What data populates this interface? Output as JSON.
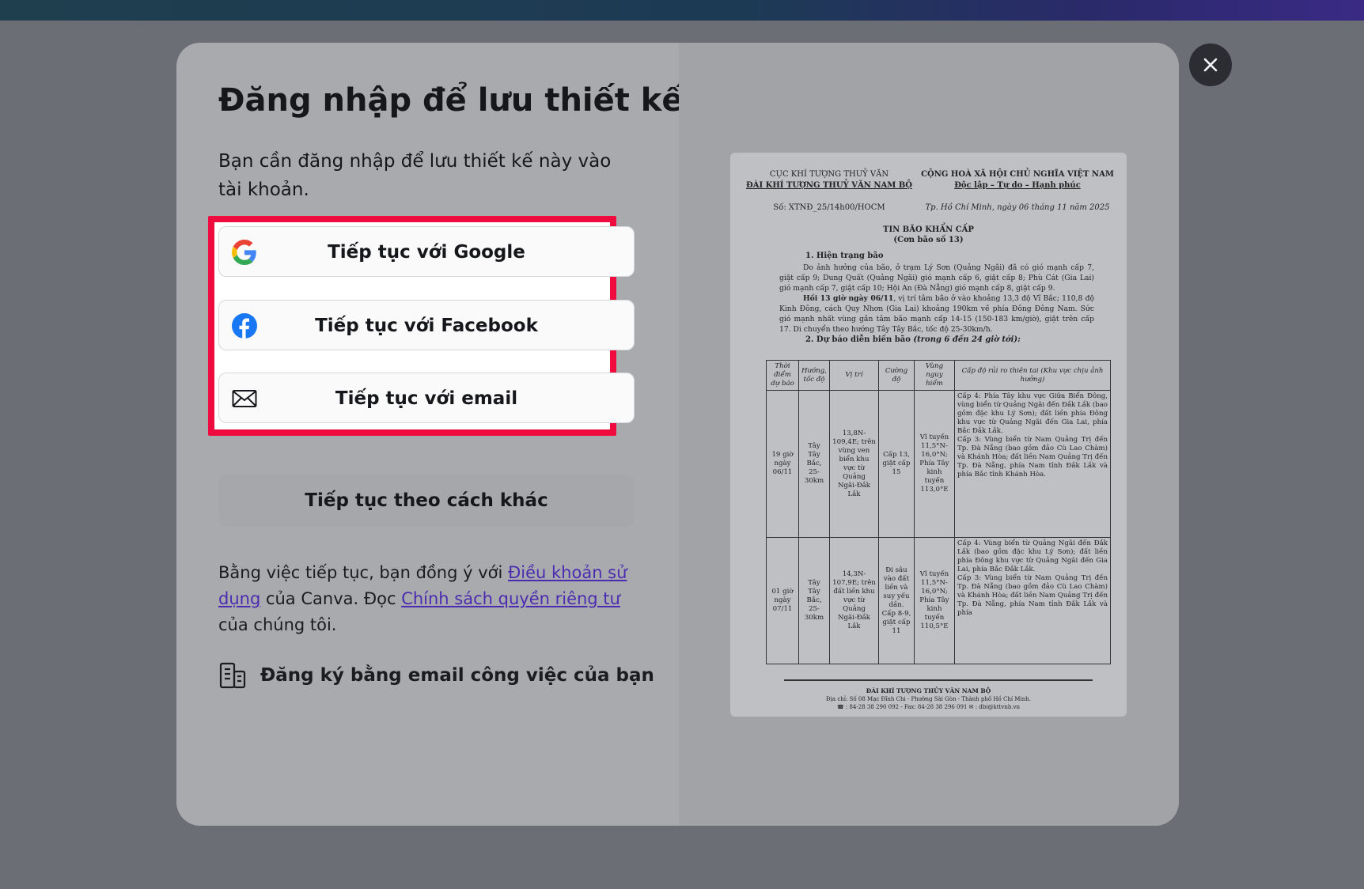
{
  "modal": {
    "title": "Đăng nhập để lưu thiết kế",
    "subtitle": "Bạn cần đăng nhập để lưu thiết kế này vào tài khoản.",
    "buttons": {
      "google": "Tiếp tục với Google",
      "facebook": "Tiếp tục với Facebook",
      "email": "Tiếp tục với email",
      "other": "Tiếp tục theo cách khác"
    },
    "terms": {
      "part1": "Bằng việc tiếp tục, bạn đồng ý với ",
      "terms_link": "Điều khoản sử dụng",
      "part2": " của Canva. Đọc ",
      "privacy_link": "Chính sách quyền riêng tư",
      "part3": " của chúng tôi."
    },
    "work_signup": "Đăng ký bằng email công việc của bạn",
    "highlight_color": "#ef0b3d",
    "link_color": "#4b2bb0"
  },
  "document": {
    "agency1": "CỤC KHÍ TƯỢNG THUỶ VĂN",
    "agency2": "ĐÀI KHÍ TƯỢNG THUỶ VĂN NAM BỘ",
    "country1": "CỘNG HOÀ XÃ HỘI CHỦ NGHĨA VIỆT NAM",
    "country2": "Độc lập – Tự do – Hạnh phúc",
    "number": "Số: XTNĐ_25/14h00/HOCM",
    "date": "Tp. Hồ Chí Minh, ngày 06 tháng 11 năm 2025",
    "heading": "TIN BÃO KHẨN CẤP",
    "subheading": "(Cơn bão số 13)",
    "section1": "1.  Hiện trạng bão",
    "para1": "Do ảnh hưởng của bão, ở trạm Lý Sơn (Quảng Ngãi) đã có gió mạnh cấp 7, giật cấp 9; Dung Quất (Quảng Ngãi) gió mạnh cấp 6, giật cấp 8; Phù Cát (Gia Lai) gió mạnh cấp 7, giật cấp 10; Hội An (Đà Nẵng) gió mạnh cấp 8, giật cấp 9.",
    "para2_bold": "Hồi 13 giờ ngày 06/11",
    "para2": ", vị trí tâm bão ở vào khoảng 13,3 độ Vĩ Bắc; 110,8 độ Kinh Đông, cách Quy Nhơn (Gia Lai) khoảng 190km về phía Đông Đông Nam. Sức gió mạnh nhất vùng gần tâm bão mạnh cấp 14-15 (150-183 km/giờ), giật trên cấp 17. Di chuyển theo hướng Tây Tây Bắc, tốc độ 25-30km/h.",
    "section2": "2. Dự báo diễn biến bão",
    "section2_note": " (trong 6 đến 24 giờ tới):",
    "table": {
      "headers": [
        "Thời điểm dự báo",
        "Hướng, tốc độ",
        "Vị trí",
        "Cường độ",
        "Vùng nguy hiểm",
        "Cấp độ rủi ro thiên tai (Khu vực chịu ảnh hưởng)"
      ],
      "rows": [
        {
          "time": "19 giờ ngày 06/11",
          "dir": "Tây Tây Bắc, 25-30km",
          "pos": "13,8N-109,4E; trên vùng ven biển khu vực từ Quảng Ngãi-Đắk Lắk",
          "intensity": "Cấp 13, giật cấp 15",
          "danger": "Vĩ tuyến 11,5°N-16,0°N; Phía Tây kinh tuyến 113,0°E",
          "risk_a": "Cấp 4: Phía Tây khu vực Giữa Biển Đông, vùng biển từ Quảng Ngãi đến Đắk Lắk (bao gồm đặc khu Lý Sơn); đất liền phía Đông khu vực từ Quảng Ngãi đến Gia Lai, phía Bắc Đắk Lắk.",
          "risk_b": "Cấp 3: Vùng biển từ Nam Quảng Trị đến Tp. Đà Nẵng (bao gồm đảo Cù Lao Chàm) và Khánh Hòa; đất liền Nam Quảng Trị đến Tp. Đà Nẵng, phía Nam tỉnh Đắk Lắk và phía Bắc tỉnh Khánh Hòa."
        },
        {
          "time": "01 giờ ngày 07/11",
          "dir": "Tây Tây Bắc, 25-30km",
          "pos": "14,3N-107,9E; trên đất liền khu vực từ Quảng Ngãi-Đắk Lắk",
          "intensity": "Đi sâu vào đất liền và suy yếu dần. Cấp 8-9, giật cấp 11",
          "danger": "Vĩ tuyến 11,5°N-16,0°N; Phía Tây kinh tuyến 110,5°E",
          "risk_a": "Cấp 4: Vùng biển từ Quảng Ngãi đến Đắk Lắk (bao gồm đặc khu Lý Sơn); đất liền phía Đông khu vực từ Quảng Ngãi đến Gia Lai, phía Bắc Đắk Lắk.",
          "risk_b": "Cấp 3: Vùng biển từ Nam Quảng Trị đến Tp. Đà Nẵng (bao gồm đảo Cù Lao Chàm) và Khánh Hòa; đất liền Nam Quảng Trị đến Tp. Đà Nẵng, phía Nam tỉnh Đắk Lắk và phía"
        }
      ]
    },
    "footer1": "ĐÀI KHÍ TƯỢNG THỦY VĂN NAM BỘ",
    "footer2": "Địa chỉ: Số 08 Mạc Đĩnh Chi - Phường Sài Gòn - Thành phố Hồ Chí Minh.",
    "footer3": "☎ : 84-28 38 290 092 - Fax: 84-28 38 296 091   ✉ : dbi@kttvnb.vn"
  }
}
